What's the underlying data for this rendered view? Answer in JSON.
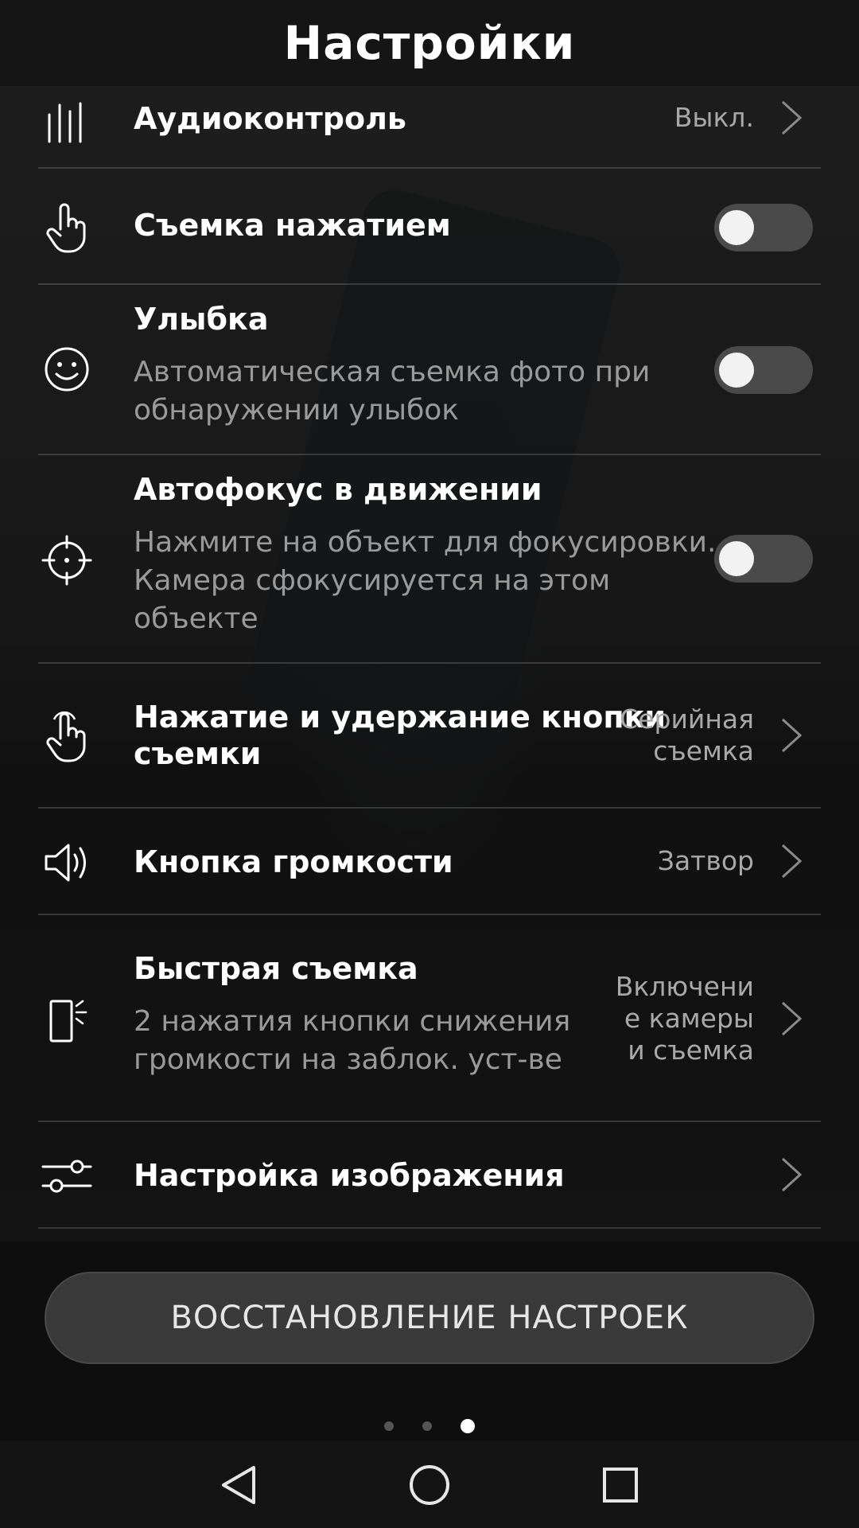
{
  "header": {
    "title": "Настройки"
  },
  "settings": [
    {
      "label": "Аудиоконтроль",
      "value": "Выкл.",
      "icon": "audio-bars-icon"
    },
    {
      "label": "Съемка нажатием",
      "icon": "tap-hand-icon",
      "toggle": false
    },
    {
      "label": "Улыбка",
      "desc_line1": "Автоматическая съемка фото при",
      "desc_line2": "обнаружении улыбок",
      "icon": "smile-icon",
      "toggle": false
    },
    {
      "label": "Автофокус в движении",
      "desc_line1": "Нажмите на объект для фокусировки.",
      "desc_line2": "Камера сфокусируется на этом",
      "desc_line3": "объекте",
      "icon": "focus-target-icon",
      "toggle": false
    },
    {
      "label_line1": "Нажатие и удержание кнопки",
      "label_line2": "съемки",
      "value_line1": "Серийная",
      "value_line2": "съемка",
      "icon": "hold-hand-icon"
    },
    {
      "label": "Кнопка громкости",
      "value": "Затвор",
      "icon": "speaker-icon"
    },
    {
      "label": "Быстрая съемка",
      "desc_line1": "2 нажатия кнопки снижения",
      "desc_line2": "громкости на заблок. уст-ве",
      "value_line1": "Включени",
      "value_line2": "е камеры",
      "value_line3": "и съемка",
      "icon": "quick-capture-icon"
    },
    {
      "label": "Настройка изображения",
      "icon": "sliders-icon"
    }
  ],
  "reset_button": "ВОССТАНОВЛЕНИЕ НАСТРОЕК",
  "pager": {
    "pages": 3,
    "current": 3
  },
  "navbar": {
    "back": "back-icon",
    "home": "home-icon",
    "recents": "recents-icon"
  }
}
